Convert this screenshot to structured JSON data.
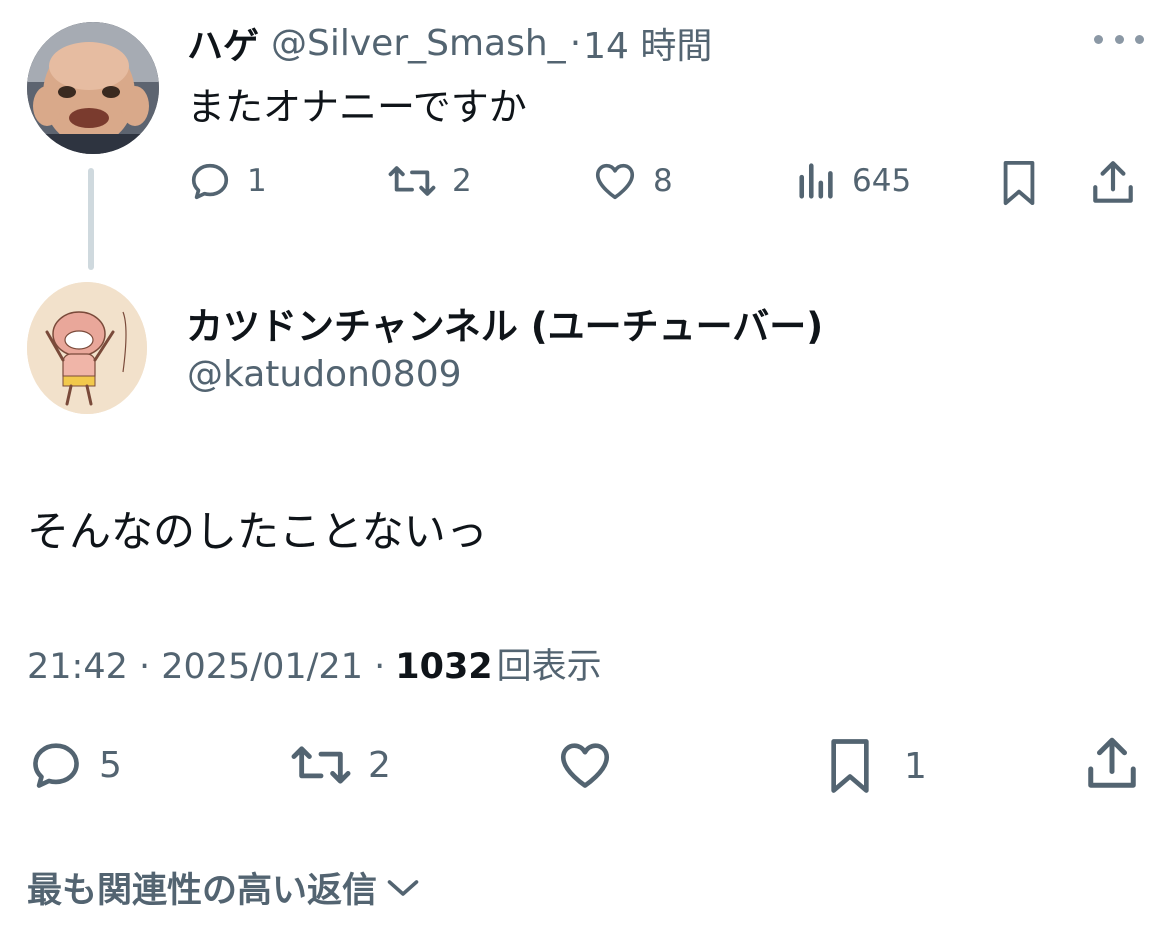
{
  "parent_tweet": {
    "display_name": "ハゲ",
    "handle": "@Silver_Smash_",
    "separator": "·",
    "time_ago": "14 時間",
    "text": "またオナニーですか",
    "more_icon": "more-horizontal-icon",
    "actions": {
      "reply_count": "1",
      "retweet_count": "2",
      "like_count": "8",
      "views_count": "645"
    }
  },
  "main_tweet": {
    "display_name": "カツドンチャンネル (ユーチューバー)",
    "handle": "@katudon0809",
    "text": "そんなのしたことないっ",
    "timestamp": "21:42 · 2025/01/21 ·",
    "views_count": "1032",
    "views_label": "回表示",
    "actions": {
      "reply_count": "5",
      "retweet_count": "2",
      "like_count": "",
      "bookmark_count": "1"
    }
  },
  "replies_sort": {
    "label": "最も関連性の高い返信"
  },
  "colors": {
    "text_primary": "#0f1419",
    "text_secondary": "#536471",
    "thread_line": "#cfd9de",
    "background": "#ffffff"
  }
}
